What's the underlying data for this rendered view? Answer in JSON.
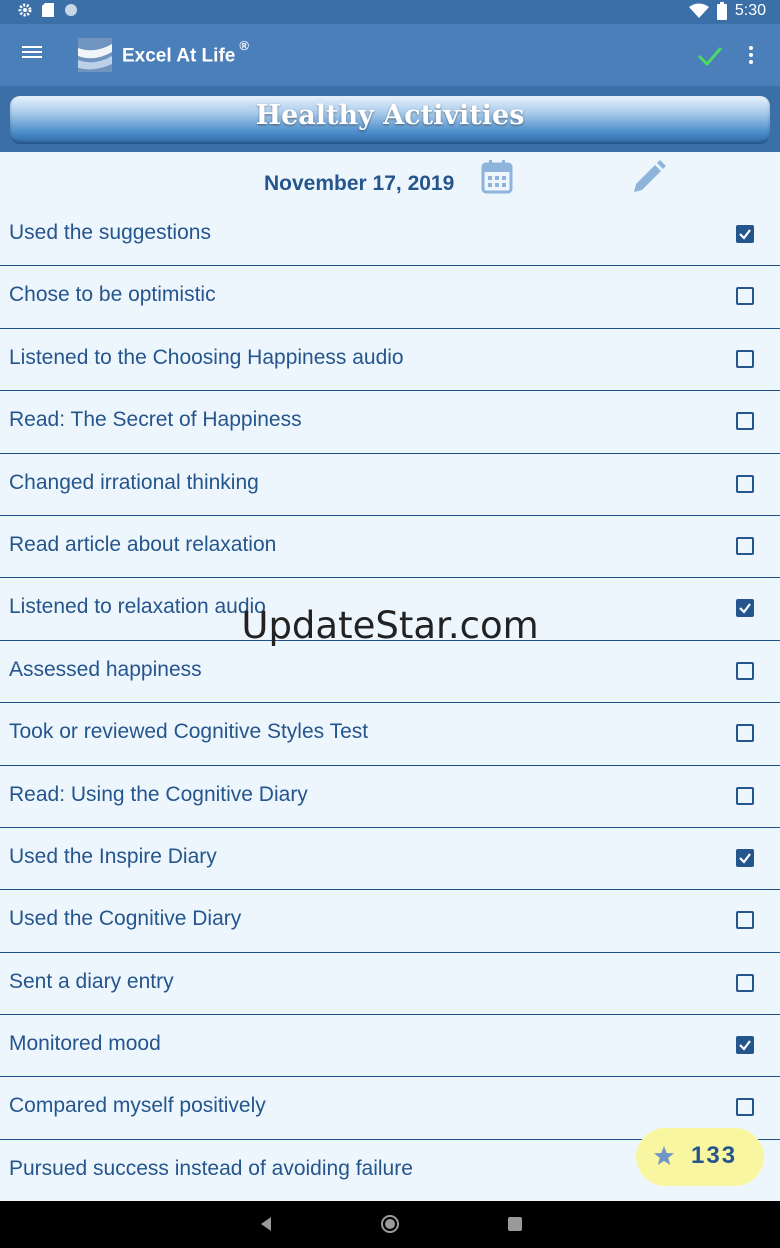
{
  "status_bar": {
    "time": "5:30",
    "left_icons": [
      "gear-icon",
      "sd-card-icon",
      "circle-icon"
    ],
    "right_icons": [
      "wifi-icon",
      "battery-icon"
    ]
  },
  "app_bar": {
    "title": "Excel At Life",
    "registered_mark": "®",
    "icons": [
      "menu-icon",
      "app-logo",
      "check-icon",
      "more-vert-icon"
    ],
    "check_color": "#4cd964"
  },
  "header": {
    "title": "Healthy Activities"
  },
  "date_row": {
    "date": "November 17, 2019",
    "icons": [
      "calendar-icon",
      "pencil-icon"
    ]
  },
  "items": [
    {
      "label": "Used the suggestions",
      "checked": true
    },
    {
      "label": "Chose to be optimistic",
      "checked": false
    },
    {
      "label": "Listened to the Choosing Happiness audio",
      "checked": false
    },
    {
      "label": "Read: The Secret of Happiness",
      "checked": false
    },
    {
      "label": "Changed irrational thinking",
      "checked": false
    },
    {
      "label": "Read article about relaxation",
      "checked": false
    },
    {
      "label": "Listened to relaxation audio",
      "checked": true
    },
    {
      "label": "Assessed happiness",
      "checked": false
    },
    {
      "label": "Took or reviewed Cognitive Styles Test",
      "checked": false
    },
    {
      "label": "Read: Using the Cognitive Diary",
      "checked": false
    },
    {
      "label": "Used the Inspire Diary",
      "checked": true
    },
    {
      "label": "Used the Cognitive Diary",
      "checked": false
    },
    {
      "label": "Sent a diary entry",
      "checked": false
    },
    {
      "label": "Monitored mood",
      "checked": true
    },
    {
      "label": "Compared myself positively",
      "checked": false
    },
    {
      "label": "Pursued success instead of avoiding failure",
      "checked": false
    }
  ],
  "points": {
    "value": "133",
    "icon": "star-icon",
    "color": "#f9f6a2"
  },
  "watermark": "UpdateStar.com",
  "nav_bar": {
    "icons": [
      "back-icon",
      "home-icon",
      "recent-apps-icon"
    ]
  },
  "colors": {
    "app_bar": "#4a7fba",
    "status_bar": "#3b6fa8",
    "text": "#25558d",
    "background": "#eef6fd"
  }
}
